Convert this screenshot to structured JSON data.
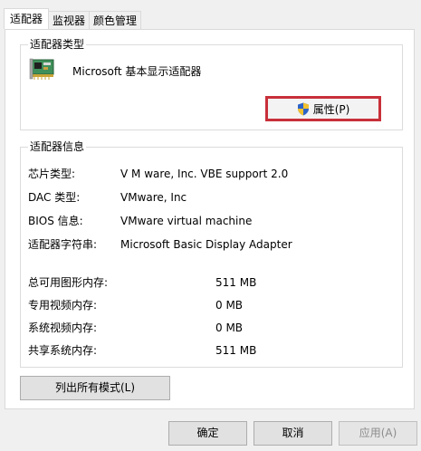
{
  "tabs": [
    {
      "label": "适配器",
      "active": true
    },
    {
      "label": "监视器",
      "active": false
    },
    {
      "label": "颜色管理",
      "active": false
    }
  ],
  "adapter_type": {
    "title": "适配器类型",
    "name": "Microsoft 基本显示适配器",
    "icon": "display-adapter-card-icon",
    "properties_button": "属性(P)"
  },
  "adapter_info": {
    "title": "适配器信息",
    "rows": [
      {
        "label": "芯片类型:",
        "value": "V M ware, Inc. VBE support 2.0"
      },
      {
        "label": "DAC 类型:",
        "value": "VMware, Inc"
      },
      {
        "label": "BIOS 信息:",
        "value": "VMware virtual machine"
      },
      {
        "label": "适配器字符串:",
        "value": "Microsoft Basic Display Adapter"
      }
    ],
    "memory": [
      {
        "label": "总可用图形内存:",
        "value": "511 MB"
      },
      {
        "label": "专用视频内存:",
        "value": "0 MB"
      },
      {
        "label": "系统视频内存:",
        "value": "0 MB"
      },
      {
        "label": "共享系统内存:",
        "value": "511 MB"
      }
    ]
  },
  "list_modes_button": "列出所有模式(L)",
  "footer": {
    "ok": "确定",
    "cancel": "取消",
    "apply": "应用(A)"
  },
  "colors": {
    "highlight_border": "#c8303a",
    "panel_bg": "#ffffff",
    "window_bg": "#f0f0f0"
  }
}
